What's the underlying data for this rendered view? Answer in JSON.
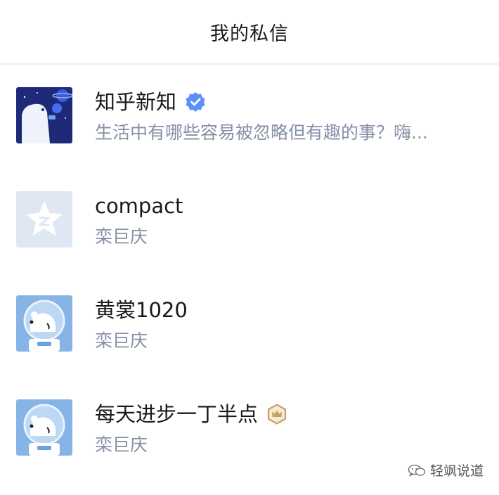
{
  "header": {
    "title": "我的私信"
  },
  "conversations": [
    {
      "name": "知乎新知",
      "preview": "生活中有哪些容易被忽略但有趣的事？嗨...",
      "avatar_icon": "space-bear-avatar-icon",
      "badge_icon": "verified-badge-icon",
      "badge_color": "#5b8ff9"
    },
    {
      "name": "compact",
      "preview": "栾巨庆",
      "avatar_icon": "default-star-avatar-icon"
    },
    {
      "name": "黄裳1020",
      "preview": "栾巨庆",
      "avatar_icon": "astronaut-bear-avatar-icon"
    },
    {
      "name": "每天进步一丁半点",
      "preview": "栾巨庆",
      "avatar_icon": "astronaut-bear-avatar-icon",
      "badge_icon": "crown-badge-icon",
      "badge_color": "#c9a063"
    }
  ],
  "watermark": {
    "text": "轻飒说道",
    "icon": "wechat-icon"
  },
  "colors": {
    "name_text": "#1a1a1a",
    "preview_text": "#8590a6",
    "divider": "#ececec"
  }
}
